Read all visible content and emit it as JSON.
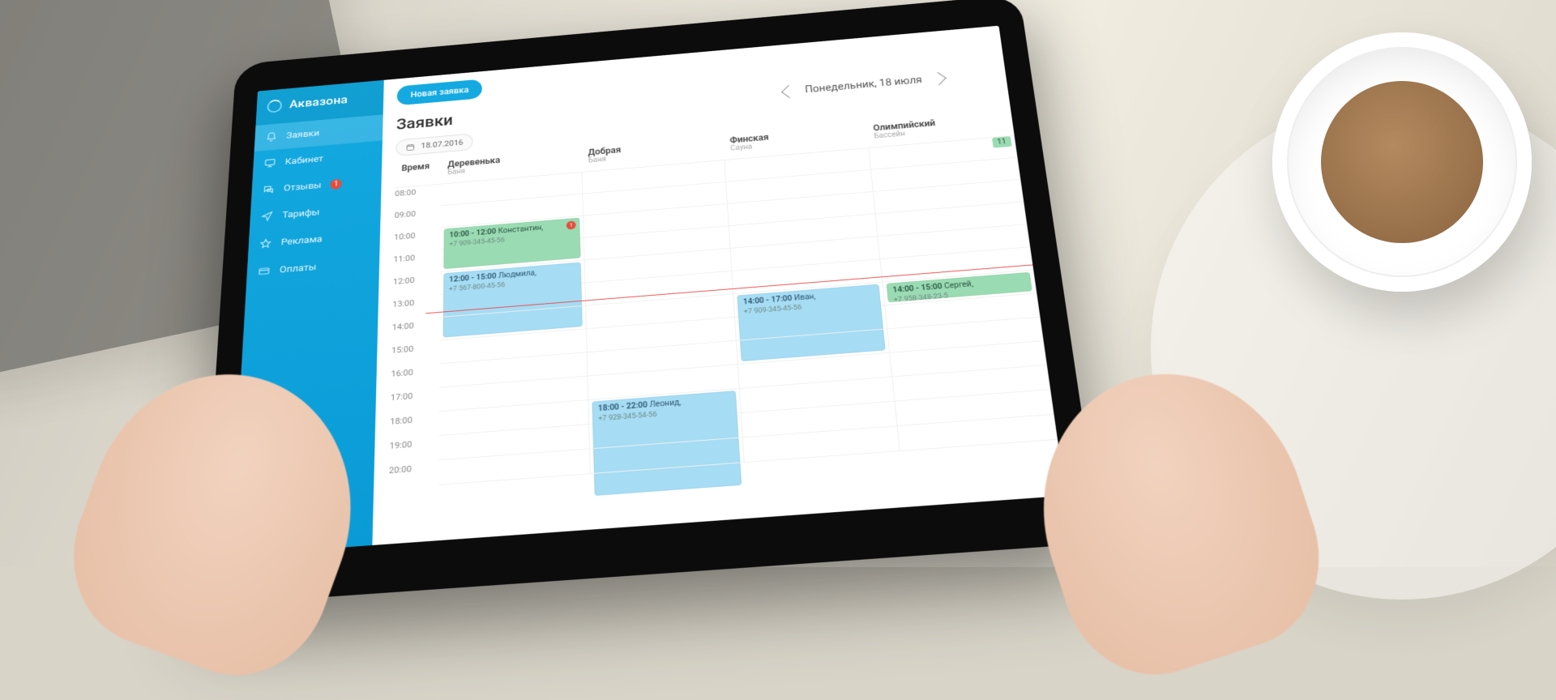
{
  "brand": {
    "name": "Аквазона"
  },
  "sidebar": {
    "items": [
      {
        "label": "Заявки",
        "icon": "bell-icon",
        "active": true,
        "badge": null
      },
      {
        "label": "Кабинет",
        "icon": "monitor-icon",
        "active": false,
        "badge": null
      },
      {
        "label": "Отзывы",
        "icon": "chat-icon",
        "active": false,
        "badge": "1"
      },
      {
        "label": "Тарифы",
        "icon": "send-icon",
        "active": false,
        "badge": null
      },
      {
        "label": "Реклама",
        "icon": "star-icon",
        "active": false,
        "badge": null
      },
      {
        "label": "Оплаты",
        "icon": "card-icon",
        "active": false,
        "badge": null
      }
    ]
  },
  "actions": {
    "new_request": "Новая заявка"
  },
  "page": {
    "title": "Заявки"
  },
  "date_nav": {
    "label": "Понедельник, 18 июля"
  },
  "date_chip": {
    "value": "18.07.2016"
  },
  "calendar": {
    "time_header": "Время",
    "hours": [
      "08:00",
      "09:00",
      "10:00",
      "11:00",
      "12:00",
      "13:00",
      "14:00",
      "15:00",
      "16:00",
      "17:00",
      "18:00",
      "19:00",
      "20:00"
    ],
    "now_row_index": 6,
    "columns": [
      {
        "title": "Деревенька",
        "subtitle": "Баня"
      },
      {
        "title": "Добрая",
        "subtitle": "Баня"
      },
      {
        "title": "Финская",
        "subtitle": "Сауна"
      },
      {
        "title": "Олимпийский",
        "subtitle": "Бассейн"
      }
    ],
    "capacity_pill": "11",
    "events": [
      {
        "col": 0,
        "start": 2,
        "span": 2,
        "color": "green",
        "time": "10:00 - 12:00",
        "name": "Константин,",
        "phone": "+7 909-345-45-56",
        "alert": "1"
      },
      {
        "col": 0,
        "start": 4,
        "span": 3,
        "color": "blue",
        "time": "12:00 - 15:00",
        "name": "Людмила,",
        "phone": "+7 567-800-45-56",
        "alert": null
      },
      {
        "col": 2,
        "start": 6,
        "span": 3,
        "color": "blue",
        "time": "14:00 - 17:00",
        "name": "Иван,",
        "phone": "+7 909-345-45-56",
        "alert": null
      },
      {
        "col": 3,
        "start": 6,
        "span": 1,
        "color": "green",
        "time": "14:00 - 15:00",
        "name": "Сергей,",
        "phone": "+7 958-348-23-5",
        "alert": null
      },
      {
        "col": 1,
        "start": 10,
        "span": 4,
        "color": "blue",
        "time": "18:00 - 22:00",
        "name": "Леонид,",
        "phone": "+7 928-345-54-56",
        "alert": null
      }
    ]
  }
}
